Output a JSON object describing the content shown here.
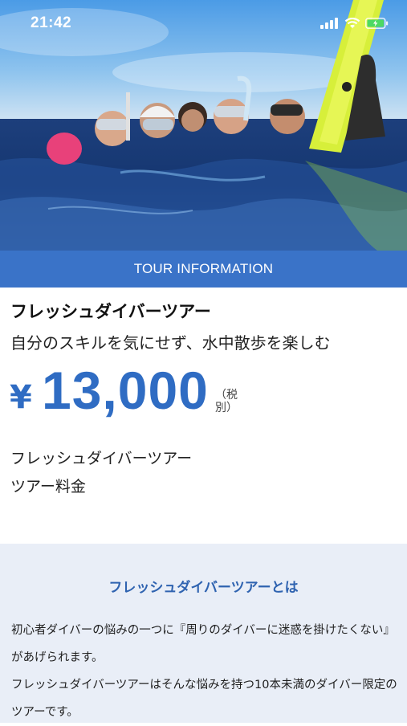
{
  "status_bar": {
    "time": "21:42",
    "icons": [
      "signal-bars-icon",
      "wifi-icon",
      "battery-charging-icon"
    ],
    "battery_color": "#4cd964"
  },
  "hero": {
    "image_subject": "snorkelers-in-ocean-photo"
  },
  "section_bar": {
    "label": "TOUR INFORMATION",
    "color": "#3a73c8"
  },
  "tour": {
    "title": "フレッシュダイバーツアー",
    "subtitle": "自分のスキルを気にせず、水中散歩を楽しむ",
    "price": {
      "symbol": "¥",
      "amount": "13,000",
      "tax_label": "（税別）",
      "color": "#2f6cc3"
    },
    "plan_name": "フレッシュダイバーツアー",
    "plan_label": "ツアー料金"
  },
  "about": {
    "heading": "フレッシュダイバーツアーとは",
    "paragraphs": [
      "初心者ダイバーの悩みの一つに『周りのダイバーに迷惑を掛けたくない』があげられます。",
      "フレッシュダイバーツアーはそんな悩みを持つ10本未満のダイバー限定のツアーです。"
    ]
  }
}
